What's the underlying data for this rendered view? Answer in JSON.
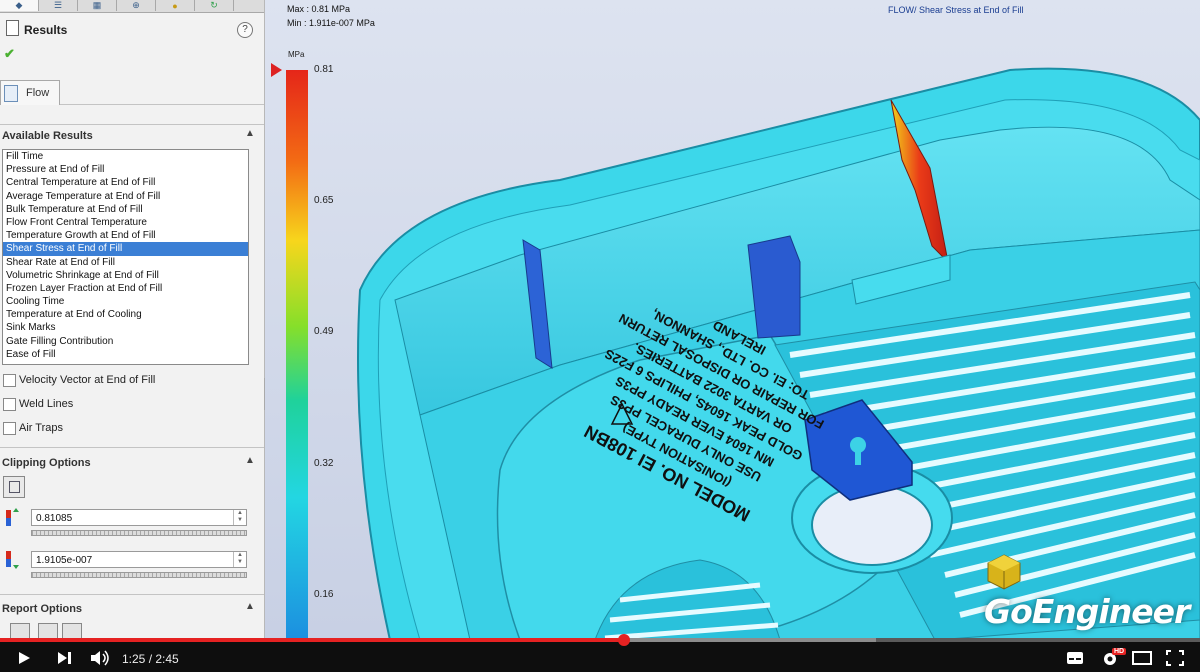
{
  "panel": {
    "results_title": "Results",
    "flow_tab": "Flow",
    "available_results_label": "Available Results",
    "results_list": [
      "Fill Time",
      "Pressure at End of Fill",
      "Central Temperature at End of Fill",
      "Average Temperature at End of Fill",
      "Bulk Temperature at End of Fill",
      "Flow Front Central Temperature",
      "Temperature Growth at End of Fill",
      "Shear Stress at End of Fill",
      "Shear Rate at End of Fill",
      "Volumetric Shrinkage at End of Fill",
      "Frozen Layer Fraction at End of Fill",
      "Cooling Time",
      "Temperature at End of Cooling",
      "Sink Marks",
      "Gate Filling Contribution",
      "Ease of Fill"
    ],
    "selected_index": 7,
    "checkboxes": [
      "Velocity Vector at End of Fill",
      "Weld Lines",
      "Air Traps"
    ],
    "clipping_label": "Clipping Options",
    "clip_max": "0.81085",
    "clip_min": "1.9105e-007",
    "report_label": "Report Options"
  },
  "viewport": {
    "max_text": "Max : 0.81 MPa",
    "min_text": "Min : 1.911e-007 MPa",
    "result_title": "FLOW/ Shear Stress at End of Fill",
    "legend_unit": "MPa",
    "legend_ticks": [
      "0.81",
      "0.65",
      "0.49",
      "0.32",
      "0.16"
    ],
    "part_label_lines": [
      "MODEL NO. EI 108BN",
      "(IONISATION TYPE)",
      "USE ONLY DURACEL PP3S",
      "MN 1604 EVER READY PP3S",
      "GOLD PEAK 1604S, PHILIPS 6 F22S",
      "OR VARTA 3022 BATTERIES.",
      "FOR REPAIR OR DISPOSAL RETURN",
      "TO: EI. CO. LTD., SHANNON,",
      "IRELAND"
    ]
  },
  "player": {
    "time": "1:25 / 2:45",
    "played_fraction": 0.52,
    "buffered_fraction": 0.73,
    "logo_text": "GoEngineer",
    "hd_badge": "HD"
  }
}
